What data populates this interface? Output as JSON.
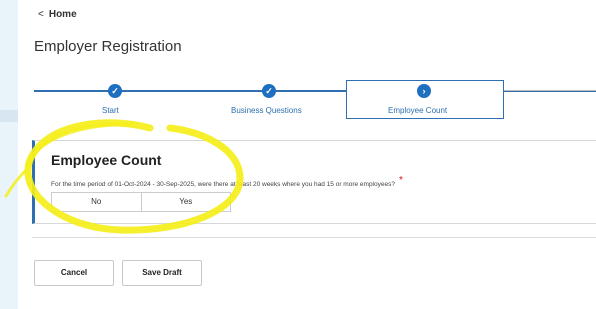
{
  "nav": {
    "back_label": "Home"
  },
  "page": {
    "title": "Employer Registration"
  },
  "stepper": {
    "steps": [
      {
        "label": "Start"
      },
      {
        "label": "Business Questions"
      },
      {
        "label": "Employee Count"
      }
    ]
  },
  "section": {
    "title": "Employee Count",
    "question": "For the time period of 01-Oct-2024 - 30-Sep-2025, were there at least 20 weeks where you had 15 or more employees?",
    "required_mark": "*",
    "options": [
      "No",
      "Yes"
    ]
  },
  "actions": {
    "cancel_label": "Cancel",
    "save_draft_label": "Save Draft"
  },
  "colors": {
    "accent": "#1f6fc1",
    "highlight": "#f4ee1a",
    "background": "#e9f3fa"
  }
}
